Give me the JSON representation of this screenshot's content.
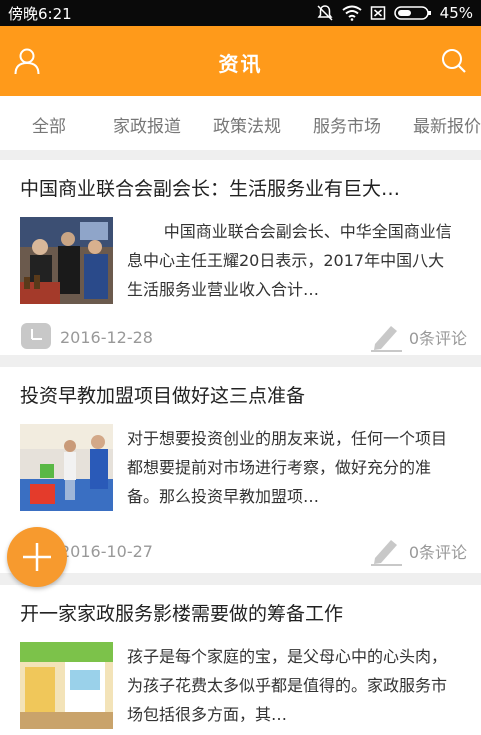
{
  "status_bar": {
    "time": "傍晚6:21",
    "battery": "45%"
  },
  "app_bar": {
    "title": "资讯"
  },
  "tabs": [
    "全部",
    "家政报道",
    "政策法规",
    "服务市场",
    "最新报价"
  ],
  "articles": [
    {
      "title": "中国商业联合会副会长：生活服务业有巨大…",
      "summary": "中国商业联合会副会长、中华全国商业信息中心主任王耀20日表示，2017年中国八大生活服务业营业收入合计…",
      "date": "2016-12-28",
      "comments": "0条评论"
    },
    {
      "title": "投资早教加盟项目做好这三点准备",
      "summary": "对于想要投资创业的朋友来说，任何一个项目都想要提前对市场进行考察，做好充分的准备。那么投资早教加盟项…",
      "date": "2016-10-27",
      "comments": "0条评论"
    },
    {
      "title": "开一家家政服务影楼需要做的筹备工作",
      "summary": "孩子是每个家庭的宝，是父母心中的心头肉，为孩子花费太多似乎都是值得的。家政服务市场包括很多方面，其…"
    }
  ],
  "colors": {
    "accent": "#ff9a1a",
    "fab": "#f79a2e"
  }
}
